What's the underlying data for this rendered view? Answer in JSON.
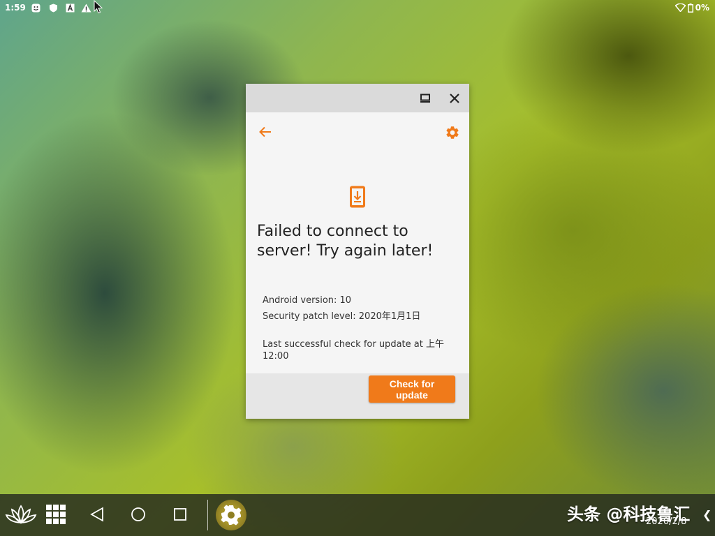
{
  "status_bar": {
    "time": "1:59",
    "battery": "0%",
    "left_icons": [
      "smiley-notification-icon",
      "shield-icon",
      "a-letter-icon",
      "warning-icon"
    ],
    "right_icons": [
      "wifi-icon",
      "battery-icon"
    ]
  },
  "window": {
    "title_buttons": [
      "maximize-icon",
      "close-icon"
    ],
    "accent_color": "#f07a1a",
    "headline": "Failed to connect to server! Try again later!",
    "android_version": "Android version: 10",
    "security_patch": "Security patch level: 2020年1月1日",
    "last_check": "Last successful check for update at 上午 12:00",
    "check_button_label": "Check for update"
  },
  "taskbar": {
    "date": "2020/2/8",
    "watermark": "头条 @科技鲁汇",
    "items": [
      "lotus-logo-icon",
      "apps-grid-icon",
      "back-icon",
      "home-icon",
      "recents-icon",
      "settings-app-icon",
      "expand-chevron-icon"
    ]
  }
}
